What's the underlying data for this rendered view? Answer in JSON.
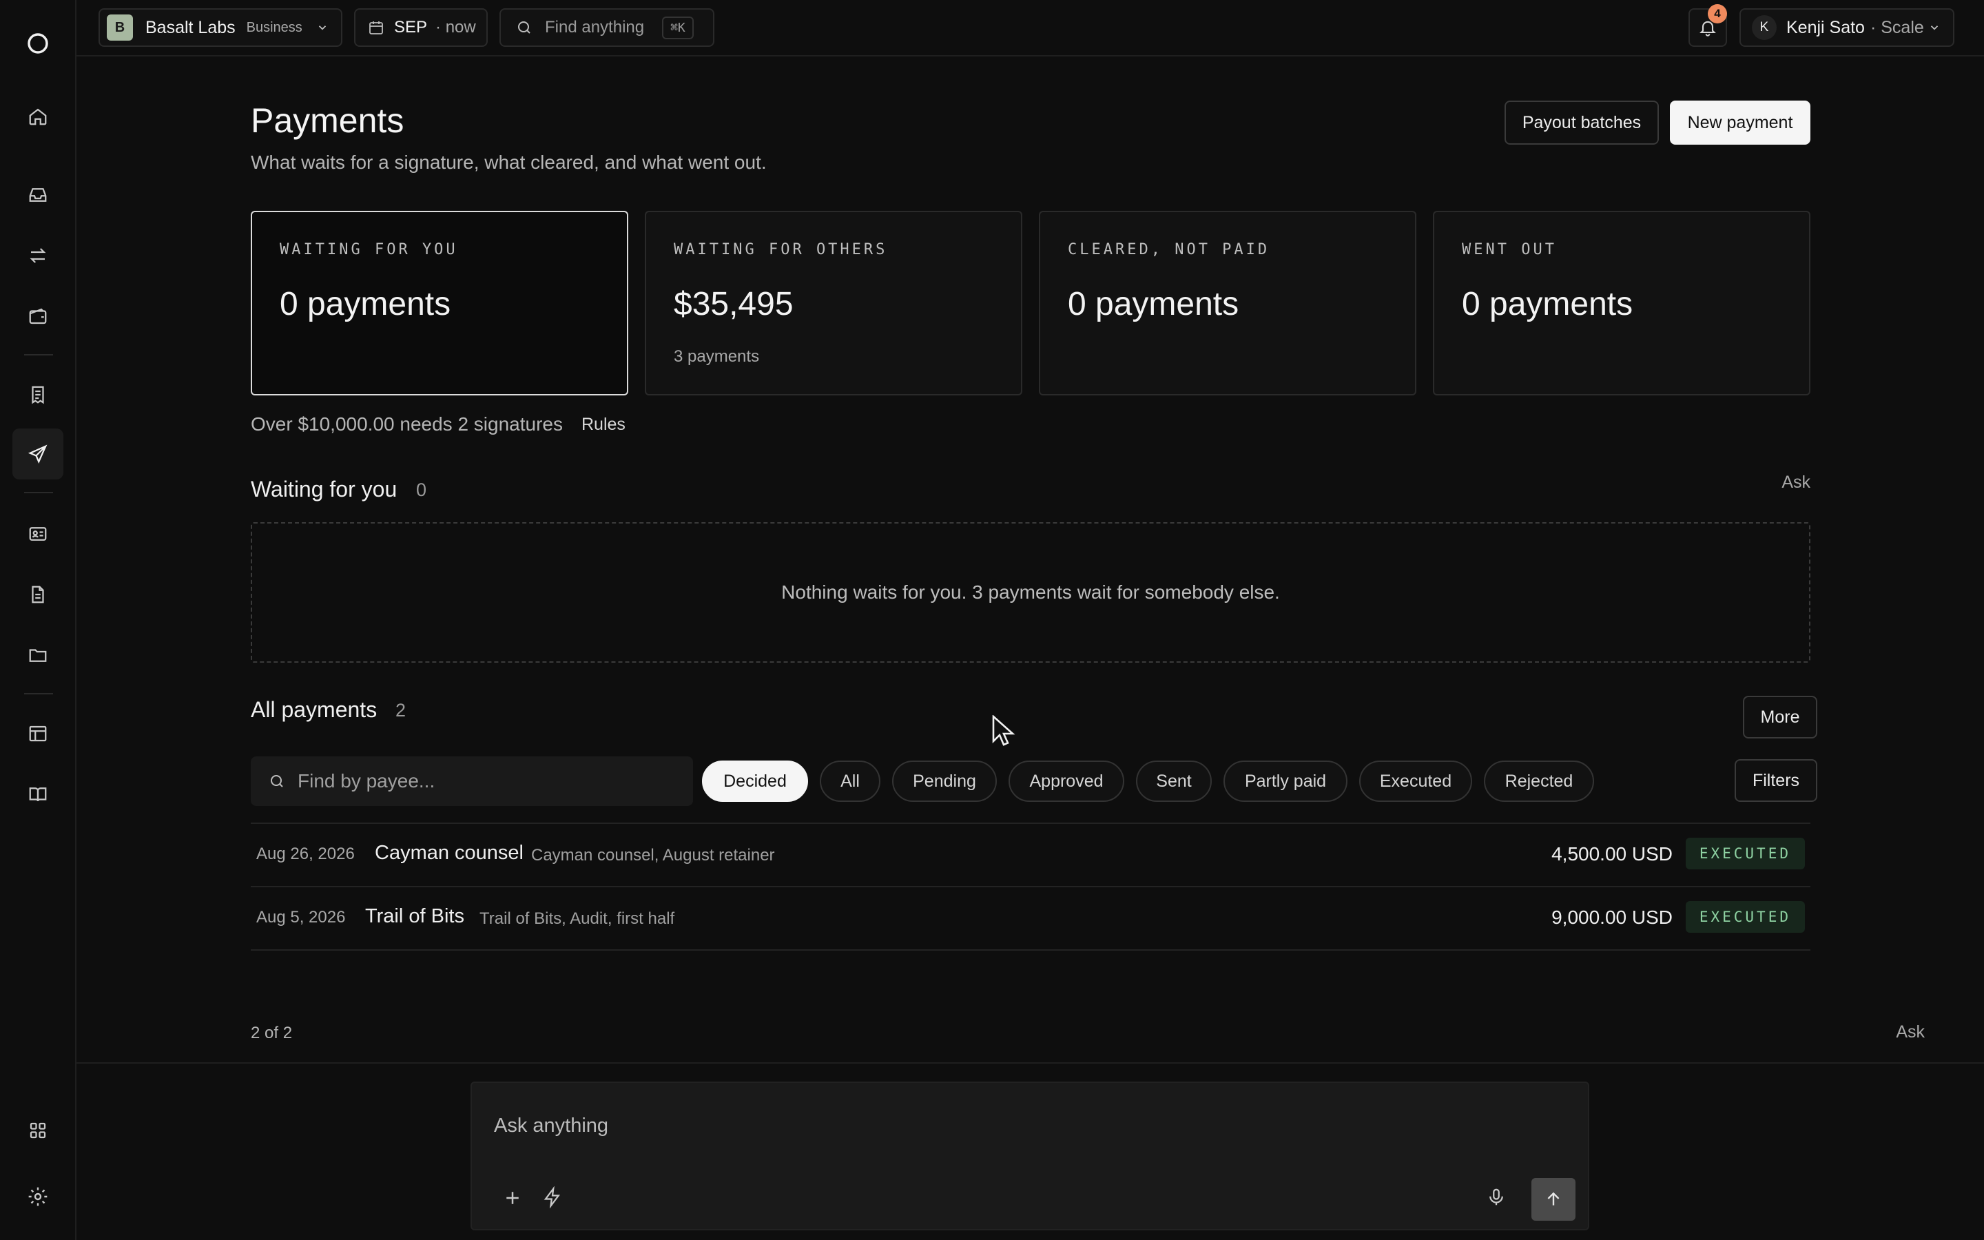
{
  "app": {
    "logo": "circle-logo"
  },
  "sidebar": {
    "icons": [
      "home-icon",
      "inbox-icon",
      "transfer-icon",
      "wallet-icon",
      "receipt-icon",
      "send-icon",
      "contacts-icon",
      "document-icon",
      "folder-icon",
      "table-icon",
      "book-icon",
      "apps-grid-icon",
      "settings-icon"
    ],
    "active": "send-icon"
  },
  "topbar": {
    "org_initial": "B",
    "org_name": "Basalt Labs",
    "org_plan": "Business",
    "period": "SEP",
    "period_suffix": "· now",
    "search_placeholder": "Find anything",
    "search_shortcut": "⌘K",
    "notif_count": "4",
    "user_initial": "K",
    "user_name": "Kenji Sato",
    "user_plan": "· Scale"
  },
  "page": {
    "title": "Payments",
    "subtitle": "What waits for a signature, what cleared, and what went out.",
    "btn_batches": "Payout batches",
    "btn_new": "New payment"
  },
  "cards": [
    {
      "label": "WAITING FOR YOU",
      "value": "0 payments",
      "sub": ""
    },
    {
      "label": "WAITING FOR OTHERS",
      "value": "$35,495",
      "sub": "3 payments"
    },
    {
      "label": "CLEARED, NOT PAID",
      "value": "0 payments",
      "sub": ""
    },
    {
      "label": "WENT OUT",
      "value": "0 payments",
      "sub": ""
    }
  ],
  "rule": {
    "text": "Over $10,000.00 needs 2 signatures",
    "link": "Rules"
  },
  "waiting": {
    "title": "Waiting for you",
    "count": "0",
    "ask": "Ask",
    "empty": "Nothing waits for you. 3 payments wait for somebody else."
  },
  "all": {
    "title": "All payments",
    "count": "2",
    "more": "More",
    "search_placeholder": "Find by payee...",
    "filters": "Filters",
    "chips": [
      "Decided",
      "All",
      "Pending",
      "Approved",
      "Sent",
      "Partly paid",
      "Executed",
      "Rejected"
    ],
    "selected_chip": "Decided",
    "rows": [
      {
        "date": "Aug 26, 2026",
        "payee": "Cayman counsel",
        "memo": "Cayman counsel, August retainer",
        "amount": "4,500.00 USD",
        "status": "EXECUTED"
      },
      {
        "date": "Aug 5, 2026",
        "payee": "Trail of Bits",
        "memo": "Trail of Bits, Audit, first half",
        "amount": "9,000.00 USD",
        "status": "EXECUTED"
      }
    ],
    "pager": "2 of 2",
    "ask": "Ask"
  },
  "askbox": {
    "placeholder": "Ask anything"
  },
  "colors": {
    "background": "#0e0e0e",
    "accent_white": "#f5f5f5",
    "executed_green": "#8fd3a3",
    "notif_orange": "#f08a5d"
  }
}
